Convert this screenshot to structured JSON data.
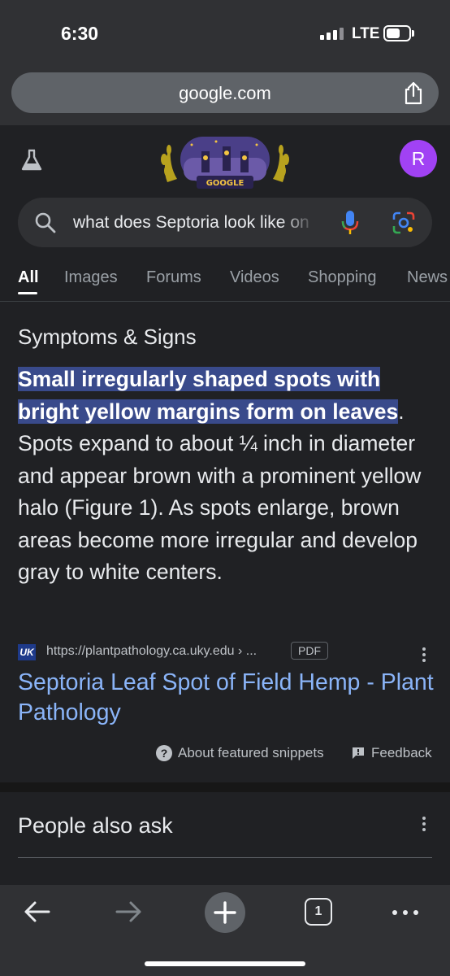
{
  "status_bar": {
    "time": "6:30",
    "network": "LTE"
  },
  "browser": {
    "url": "google.com",
    "open_tabs": "1"
  },
  "header": {
    "avatar_initial": "R",
    "doodle_text": "GOOGLE"
  },
  "search": {
    "query": "what does Septoria look like on"
  },
  "tabs": [
    {
      "label": "All",
      "active": true
    },
    {
      "label": "Images"
    },
    {
      "label": "Forums"
    },
    {
      "label": "Videos"
    },
    {
      "label": "Shopping"
    },
    {
      "label": "News"
    }
  ],
  "featured_snippet": {
    "heading": "Symptoms & Signs",
    "highlight_line1": "Small irregularly shaped spots with",
    "highlight_line2": "bright yellow margins form on leaves",
    "rest": ". Spots expand to about ¼ inch in diameter and appear brown with a prominent yellow halo (Figure 1). As spots enlarge, brown areas become more irregular and develop gray to white centers.",
    "source_logo": "UK",
    "source_url": "https://plantpathology.ca.uky.edu › ...",
    "file_type": "PDF",
    "result_title": "Septoria Leaf Spot of Field Hemp - Plant Pathology",
    "about_label": "About featured snippets",
    "feedback_label": "Feedback"
  },
  "people_also_ask": {
    "heading": "People also ask"
  },
  "colors": {
    "background": "#202124",
    "highlight": "#394a8b",
    "link": "#8ab4f8",
    "avatar": "#a142f4"
  }
}
